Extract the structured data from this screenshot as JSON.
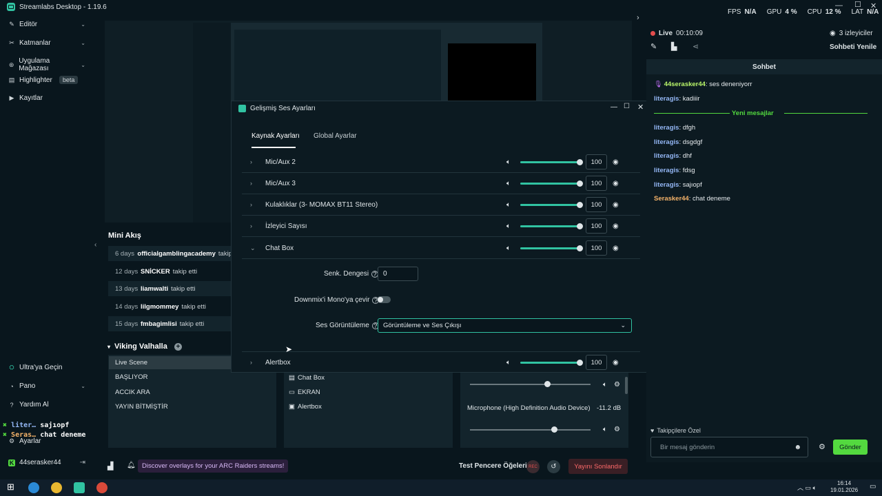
{
  "app": {
    "title": "Streamlabs Desktop - 1.19.6"
  },
  "stats": {
    "fps_label": "FPS",
    "fps": "N/A",
    "gpu_label": "GPU",
    "gpu": "4 %",
    "cpu_label": "CPU",
    "cpu": "12 %",
    "lat_label": "LAT",
    "lat": "N/A"
  },
  "nav": {
    "items": [
      {
        "label": "Editör"
      },
      {
        "label": "Katmanlar"
      },
      {
        "label": "Uygulama Mağazası"
      },
      {
        "label": "Highlighter",
        "badge": "beta"
      },
      {
        "label": "Kayıtlar"
      }
    ],
    "bottom": [
      {
        "label": "Ultra'ya Geçin"
      },
      {
        "label": "Pano"
      },
      {
        "label": "Yardım Al"
      },
      {
        "label": "Ayarlar"
      }
    ],
    "user": "44serasker44"
  },
  "overlay_chat": [
    {
      "user": "liter…",
      "msg": "sajıopf"
    },
    {
      "user": "Seras…",
      "msg": "chat deneme"
    }
  ],
  "minifeed": {
    "title": "Mini Akış",
    "rows": [
      {
        "days": "6 days",
        "user": "officialgamblingacademy",
        "action": "takip"
      },
      {
        "days": "12 days",
        "user": "SNİCKER",
        "action": "takip etti"
      },
      {
        "days": "13 days",
        "user": "liamwalti",
        "action": "takip etti"
      },
      {
        "days": "14 days",
        "user": "lilgmommey",
        "action": "takip etti"
      },
      {
        "days": "15 days",
        "user": "fmbagimlisi",
        "action": "takip etti"
      }
    ]
  },
  "scenes": {
    "title": "Viking Valhalla",
    "items": [
      "Live Scene",
      "BAŞLIYOR",
      "ACCIK ARA",
      "YAYIN BİTMİŞTİR"
    ]
  },
  "sources": [
    "Chat Box",
    "EKRAN",
    "Alertbox"
  ],
  "mixer": {
    "mic_label": "Microphone (High Definition Audio Device)",
    "mic_db": "-11.2 dB"
  },
  "dialog": {
    "title": "Gelişmiş Ses Ayarları",
    "tabs": [
      "Kaynak Ayarları",
      "Global Ayarlar"
    ],
    "rows": [
      {
        "name": "Mic/Aux 2",
        "value": "100"
      },
      {
        "name": "Mic/Aux 3",
        "value": "100"
      },
      {
        "name": "Kulaklıklar (3- MOMAX BT11 Stereo)",
        "value": "100"
      },
      {
        "name": "İzleyici Sayısı",
        "value": "100"
      },
      {
        "name": "Chat Box",
        "value": "100"
      }
    ],
    "expanded": {
      "sync_label": "Senk. Dengesi",
      "sync_value": "0",
      "downmix_label": "Downmix'i Mono'ya çevir",
      "monitor_label": "Ses Görüntüleme",
      "monitor_value": "Görüntüleme ve Ses Çıkışı"
    },
    "last_row": {
      "name": "Alertbox",
      "value": "100"
    }
  },
  "live": {
    "status": "Live",
    "time": "00:10:09",
    "viewers": "3 izleyiciler",
    "refresh": "Sohbeti Yenile"
  },
  "chat": {
    "title": "Sohbet",
    "new_messages": "Yeni mesajlar",
    "messages_before": [
      {
        "user": "44serasker44",
        "msg": ": ses deneniyorr",
        "color": "#b9f56a"
      },
      {
        "user": "literagis",
        "msg": ": kadiiir",
        "color": "#94b7f5"
      }
    ],
    "messages_after": [
      {
        "user": "literagis",
        "msg": ": dfgh",
        "color": "#94b7f5"
      },
      {
        "user": "literagis",
        "msg": ": dsgdgf",
        "color": "#94b7f5"
      },
      {
        "user": "literagis",
        "msg": ": dhf",
        "color": "#94b7f5"
      },
      {
        "user": "literagis",
        "msg": ": fdsg",
        "color": "#94b7f5"
      },
      {
        "user": "literagis",
        "msg": ": sajıopf",
        "color": "#94b7f5"
      },
      {
        "user": "Serasker44",
        "msg": ": chat deneme",
        "color": "#f5b36a"
      }
    ],
    "followers_only": "Takipçilere Özel",
    "placeholder": "Bir mesaj gönderin",
    "send": "Gönder"
  },
  "bottombar": {
    "promo": "Discover overlays for your ARC Raiders streams!",
    "test": "Test Pencere Öğeleri",
    "rec": "REC",
    "end": "Yayını Sonlandır"
  },
  "taskbar": {
    "time": "16:14",
    "date": "19.01.2026"
  },
  "colors": {
    "accent": "#31c3a2",
    "bg": "#09161d",
    "send_button": "#53d93f",
    "end_stream": "#e34d4d"
  }
}
